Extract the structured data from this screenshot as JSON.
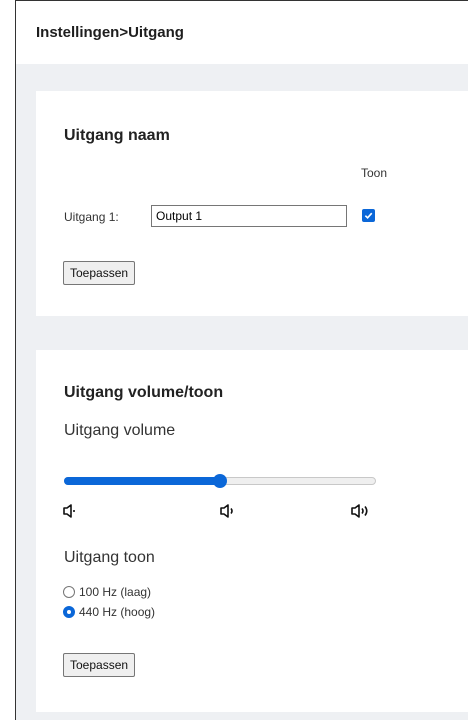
{
  "header": {
    "breadcrumb": "Instellingen>Uitgang"
  },
  "output_name_card": {
    "title": "Uitgang naam",
    "column_label": "Toon",
    "row_label": "Uitgang 1:",
    "input_value": "Output 1",
    "show_checked": true,
    "apply_label": "Toepassen"
  },
  "volume_card": {
    "title": "Uitgang volume/toon",
    "volume_label": "Uitgang volume",
    "volume_level": 0.5,
    "icons": [
      "volume-low-icon",
      "volume-medium-icon",
      "volume-high-icon"
    ],
    "tone_label": "Uitgang toon",
    "tone_options": [
      {
        "label": "100 Hz (laag)",
        "selected": false
      },
      {
        "label": "440 Hz (hoog)",
        "selected": true
      }
    ],
    "apply_label": "Toepassen"
  },
  "colors": {
    "accent": "#0b67d8",
    "background": "#eef0f3"
  }
}
